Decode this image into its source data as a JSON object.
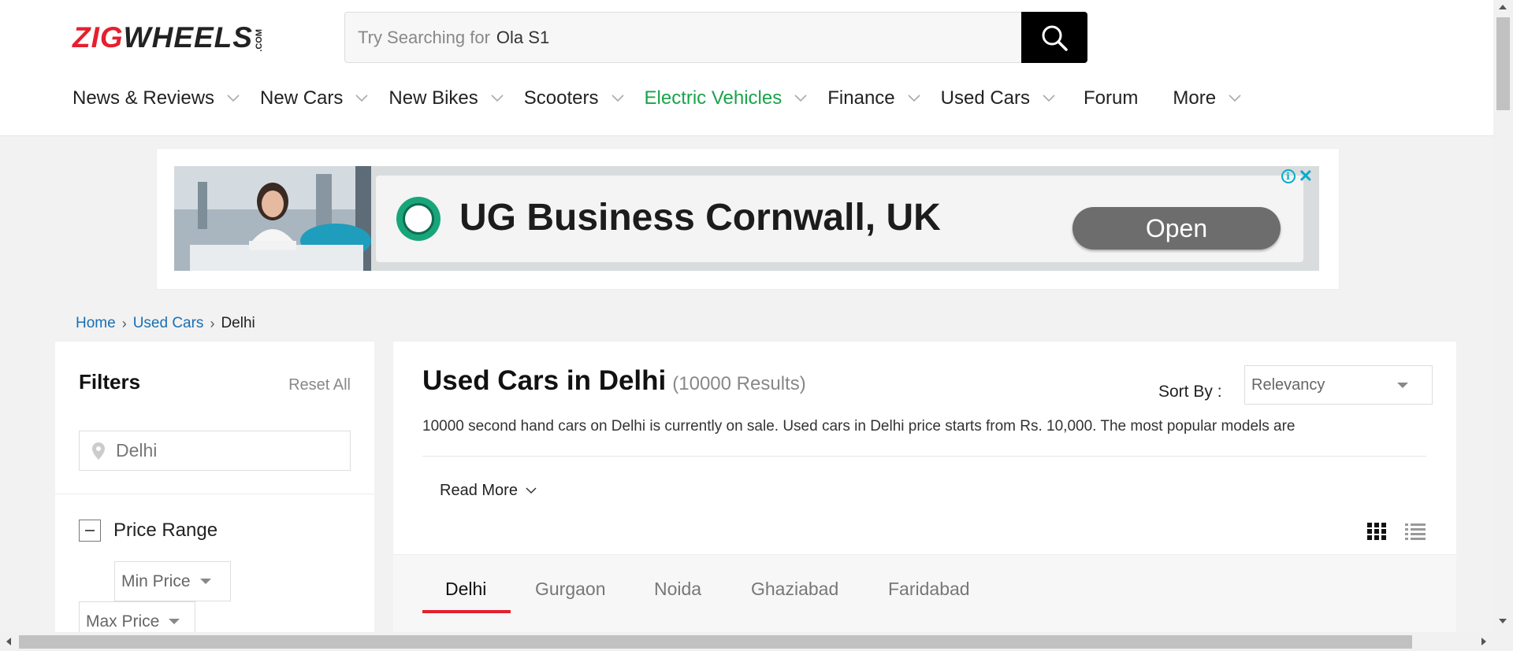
{
  "header": {
    "logo": {
      "zig": "ZIG",
      "wheels": "WHEELS",
      "com": ".COM"
    },
    "search": {
      "prefix": "Try Searching for",
      "term": "Ola S1",
      "icon": "search-icon"
    },
    "nav": [
      {
        "label": "News & Reviews",
        "has_dropdown": true
      },
      {
        "label": "New Cars",
        "has_dropdown": true
      },
      {
        "label": "New Bikes",
        "has_dropdown": true
      },
      {
        "label": "Scooters",
        "has_dropdown": true
      },
      {
        "label": "Electric Vehicles",
        "has_dropdown": true,
        "color": "#1aa34a"
      },
      {
        "label": "Finance",
        "has_dropdown": true
      },
      {
        "label": "Used Cars",
        "has_dropdown": true
      },
      {
        "label": "Forum",
        "has_dropdown": false
      },
      {
        "label": "More",
        "has_dropdown": true
      }
    ]
  },
  "ad": {
    "title": "UG Business Cornwall, UK",
    "cta": "Open",
    "info_icon": "i",
    "close_icon": "✕"
  },
  "breadcrumb": {
    "home": "Home",
    "section": "Used Cars",
    "current": "Delhi",
    "separator": "›"
  },
  "filters": {
    "title": "Filters",
    "reset": "Reset All",
    "location_value": "Delhi",
    "price_range": {
      "label": "Price Range",
      "min": "Min Price",
      "max": "Max Price"
    }
  },
  "main": {
    "title": "Used Cars in Delhi",
    "results": "(10000 Results)",
    "sort_label": "Sort By :",
    "sort_value": "Relevancy",
    "description": "10000 second hand cars on Delhi is currently on sale. Used cars in Delhi price starts from Rs. 10,000. The most popular models are",
    "read_more": "Read More",
    "tabs": [
      "Delhi",
      "Gurgaon",
      "Noida",
      "Ghaziabad",
      "Faridabad"
    ],
    "active_tab": "Delhi"
  },
  "colors": {
    "brand_red": "#e5202e",
    "link_blue": "#1a6fb3",
    "ev_green": "#1aa34a"
  }
}
